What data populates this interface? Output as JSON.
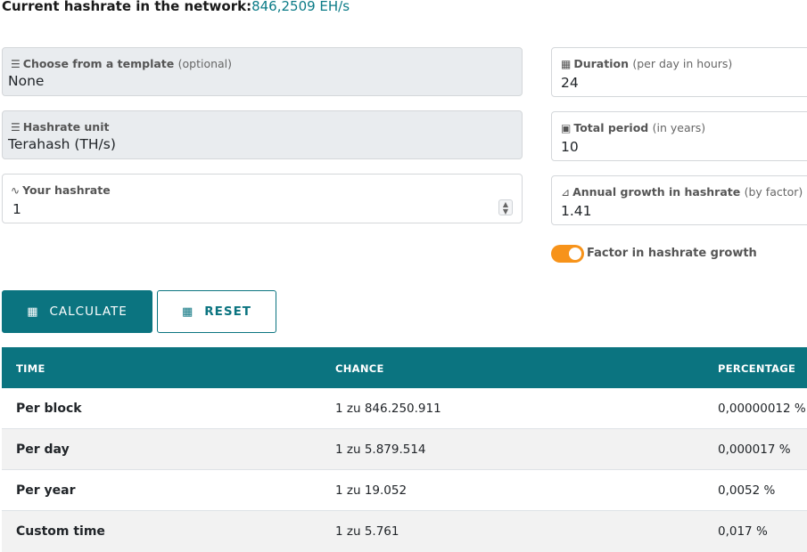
{
  "network": {
    "label": "Current hashrate in the network:",
    "value": "846,2509 EH/s"
  },
  "fields": {
    "template": {
      "icon": "list-icon",
      "label": "Choose from a template",
      "hint": "(optional)",
      "value": "None"
    },
    "unit": {
      "icon": "list-icon",
      "label": "Hashrate unit",
      "hint": "",
      "value": "Terahash (TH/s)"
    },
    "hashrate": {
      "icon": "pulse-icon",
      "label": "Your hashrate",
      "hint": "",
      "value": "1"
    },
    "duration": {
      "icon": "calculator-icon",
      "label": "Duration",
      "hint": "(per day in hours)",
      "value": "24"
    },
    "period": {
      "icon": "calendar-icon",
      "label": "Total period",
      "hint": "(in years)",
      "value": "10"
    },
    "growth": {
      "icon": "chart-icon",
      "label": "Annual growth in hashrate",
      "hint": "(by factor)",
      "value": "1.41"
    }
  },
  "toggle": {
    "label": "Factor in hashrate growth",
    "on": true,
    "color": "#f7931a"
  },
  "buttons": {
    "calculate": "CALCULATE",
    "reset": "RESET"
  },
  "colors": {
    "accent": "#0b7480",
    "toggle": "#f7931a"
  },
  "table": {
    "headers": [
      "TIME",
      "CHANCE",
      "PERCENTAGE"
    ],
    "rows": [
      {
        "time": "Per block",
        "chance": "1 zu 846.250.911",
        "percentage": "0,00000012 %"
      },
      {
        "time": "Per day",
        "chance": "1 zu 5.879.514",
        "percentage": "0,000017 %"
      },
      {
        "time": "Per year",
        "chance": "1 zu 19.052",
        "percentage": "0,0052 %"
      },
      {
        "time": "Custom time",
        "chance": "1 zu 5.761",
        "percentage": "0,017 %"
      }
    ]
  }
}
